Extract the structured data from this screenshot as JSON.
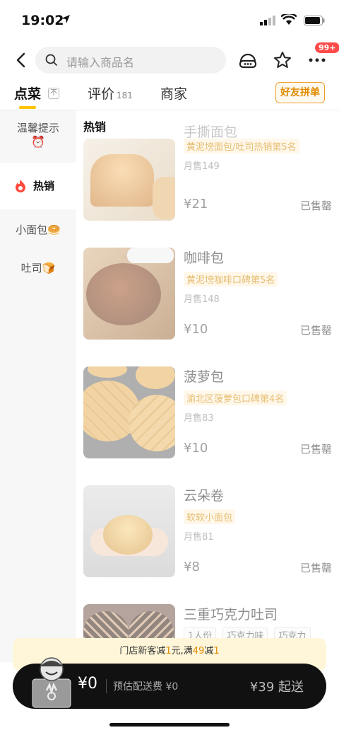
{
  "status_bar": {
    "time": "19:02"
  },
  "header": {
    "search_placeholder": "请输入商品名",
    "badge": "99+"
  },
  "tabs": {
    "order": "点菜",
    "pin": "不",
    "reviews": "评价",
    "reviews_count": "181",
    "merchant": "商家",
    "group_order": "好友拼单"
  },
  "sidebar": {
    "items": [
      {
        "label": "温馨提示",
        "emoji": "⏰"
      },
      {
        "label": "热销"
      },
      {
        "label": "小面包",
        "emoji": "🥯"
      },
      {
        "label": "吐司",
        "emoji": "🍞"
      }
    ]
  },
  "section": {
    "title": "热销"
  },
  "products": [
    {
      "name": "手撕面包",
      "tag": "黄泥塝面包/吐司热销第5名",
      "sales": "月售149",
      "price": "¥21",
      "status": "已售罄"
    },
    {
      "name": "咖啡包",
      "tag": "黄泥塝咖啡口碑第5名",
      "sales": "月售148",
      "price": "¥10",
      "status": "已售罄"
    },
    {
      "name": "菠萝包",
      "tag": "渝北区菠萝包口碑第4名",
      "sales": "月售83",
      "price": "¥10",
      "status": "已售罄"
    },
    {
      "name": "云朵卷",
      "tag": "软软小面包",
      "sales": "月售81",
      "price": "¥8",
      "status": "已售罄"
    },
    {
      "name": "三重巧克力吐司",
      "specs": [
        "1人份",
        "巧克力味",
        "巧克力"
      ]
    }
  ],
  "promo": {
    "prefix": "门店新客减",
    "a": "1",
    "mid": "元,满",
    "b": "49",
    "mid2": "减",
    "c": "1"
  },
  "cart": {
    "total": "¥0",
    "fee": "预估配送费 ¥0",
    "min": "¥39 起送"
  },
  "colors": {
    "accent": "#ffc300",
    "tag_text": "#d28a00",
    "badge": "#ff4a4a"
  }
}
